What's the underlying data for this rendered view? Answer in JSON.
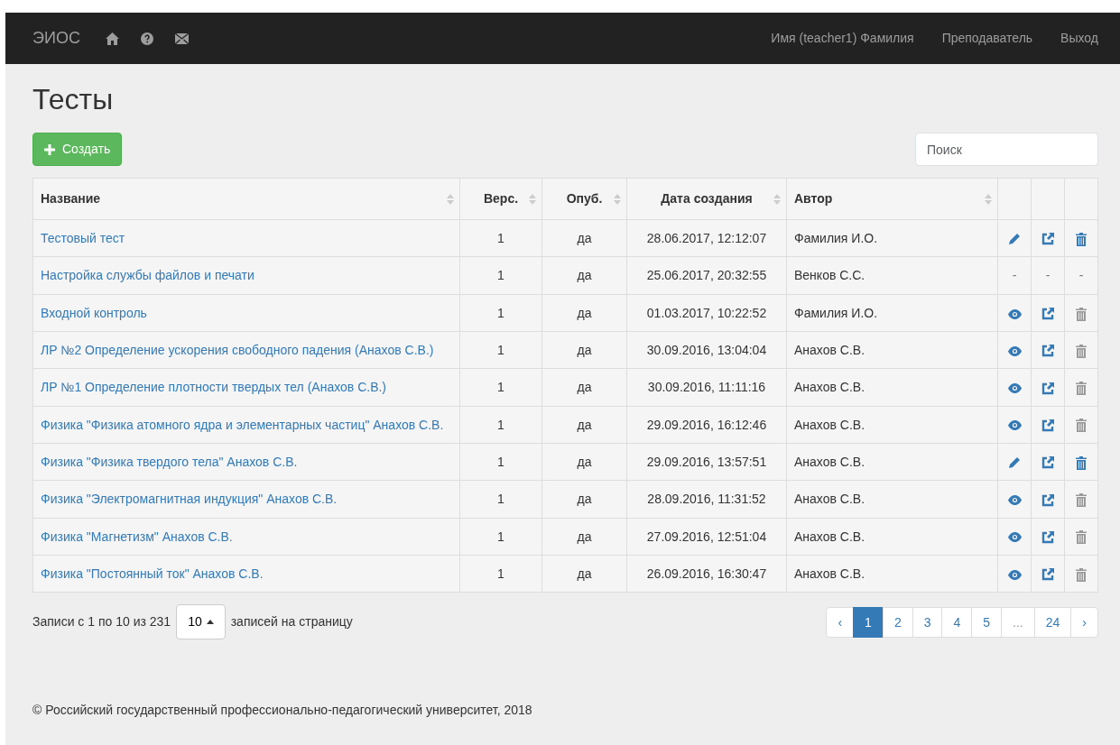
{
  "navbar": {
    "brand": "ЭИОС",
    "user": "Имя (teacher1) Фамилия",
    "role": "Преподаватель",
    "logout": "Выход"
  },
  "page_title": "Тесты",
  "create_button": "Создать",
  "search": {
    "placeholder": "Поиск"
  },
  "table": {
    "columns": [
      {
        "label": "Название",
        "sortable": true
      },
      {
        "label": "Верс.",
        "sortable": true
      },
      {
        "label": "Опуб.",
        "sortable": true
      },
      {
        "label": "Дата создания",
        "sortable": true
      },
      {
        "label": "Автор",
        "sortable": true
      }
    ],
    "rows": [
      {
        "name": "Тестовый тест",
        "version": "1",
        "published": "да",
        "created": "28.06.2017, 12:12:07",
        "author": "Фамилия И.О.",
        "actions": [
          {
            "kind": "edit"
          },
          {
            "kind": "open"
          },
          {
            "kind": "delete",
            "disabled": false
          }
        ]
      },
      {
        "name": "Настройка службы файлов и печати",
        "version": "1",
        "published": "да",
        "created": "25.06.2017, 20:32:55",
        "author": "Венков С.С.",
        "actions": [
          {
            "kind": "dash",
            "text": "-"
          },
          {
            "kind": "dash",
            "text": "-"
          },
          {
            "kind": "dash",
            "text": "-"
          }
        ]
      },
      {
        "name": "Входной контроль",
        "version": "1",
        "published": "да",
        "created": "01.03.2017, 10:22:52",
        "author": "Фамилия И.О.",
        "actions": [
          {
            "kind": "view"
          },
          {
            "kind": "open"
          },
          {
            "kind": "delete",
            "disabled": true
          }
        ]
      },
      {
        "name": "ЛР №2 Определение ускорения свободного падения (Анахов С.В.)",
        "version": "1",
        "published": "да",
        "created": "30.09.2016, 13:04:04",
        "author": "Анахов С.В.",
        "actions": [
          {
            "kind": "view"
          },
          {
            "kind": "open"
          },
          {
            "kind": "delete",
            "disabled": true
          }
        ]
      },
      {
        "name": "ЛР №1 Определение плотности твердых тел (Анахов С.В.)",
        "version": "1",
        "published": "да",
        "created": "30.09.2016, 11:11:16",
        "author": "Анахов С.В.",
        "actions": [
          {
            "kind": "view"
          },
          {
            "kind": "open"
          },
          {
            "kind": "delete",
            "disabled": true
          }
        ]
      },
      {
        "name": "Физика \"Физика атомного ядра и элементарных частиц\" Анахов С.В.",
        "version": "1",
        "published": "да",
        "created": "29.09.2016, 16:12:46",
        "author": "Анахов С.В.",
        "actions": [
          {
            "kind": "view"
          },
          {
            "kind": "open"
          },
          {
            "kind": "delete",
            "disabled": true
          }
        ]
      },
      {
        "name": "Физика \"Физика твердого тела\" Анахов С.В.",
        "version": "1",
        "published": "да",
        "created": "29.09.2016, 13:57:51",
        "author": "Анахов С.В.",
        "actions": [
          {
            "kind": "edit"
          },
          {
            "kind": "open"
          },
          {
            "kind": "delete",
            "disabled": false
          }
        ]
      },
      {
        "name": "Физика \"Электромагнитная индукция\" Анахов С.В.",
        "version": "1",
        "published": "да",
        "created": "28.09.2016, 11:31:52",
        "author": "Анахов С.В.",
        "actions": [
          {
            "kind": "view"
          },
          {
            "kind": "open"
          },
          {
            "kind": "delete",
            "disabled": true
          }
        ]
      },
      {
        "name": "Физика \"Магнетизм\" Анахов С.В.",
        "version": "1",
        "published": "да",
        "created": "27.09.2016, 12:51:04",
        "author": "Анахов С.В.",
        "actions": [
          {
            "kind": "view"
          },
          {
            "kind": "open"
          },
          {
            "kind": "delete",
            "disabled": true
          }
        ]
      },
      {
        "name": "Физика \"Постоянный ток\" Анахов С.В.",
        "version": "1",
        "published": "да",
        "created": "26.09.2016, 16:30:47",
        "author": "Анахов С.В.",
        "actions": [
          {
            "kind": "view"
          },
          {
            "kind": "open"
          },
          {
            "kind": "delete",
            "disabled": true
          }
        ]
      }
    ]
  },
  "info": "Записи с 1 по 10 из 231",
  "page_size": "10",
  "page_size_label": "записей на страницу",
  "pagination": [
    {
      "label": "‹",
      "selected": false
    },
    {
      "label": "1",
      "selected": true
    },
    {
      "label": "2",
      "selected": false
    },
    {
      "label": "3",
      "selected": false
    },
    {
      "label": "4",
      "selected": false
    },
    {
      "label": "5",
      "selected": false
    },
    {
      "label": "...",
      "selected": false,
      "disabled": true
    },
    {
      "label": "24",
      "selected": false
    },
    {
      "label": "›",
      "selected": false
    }
  ],
  "footer": "© Российский государственный профессионально-педагогический университет, 2018"
}
